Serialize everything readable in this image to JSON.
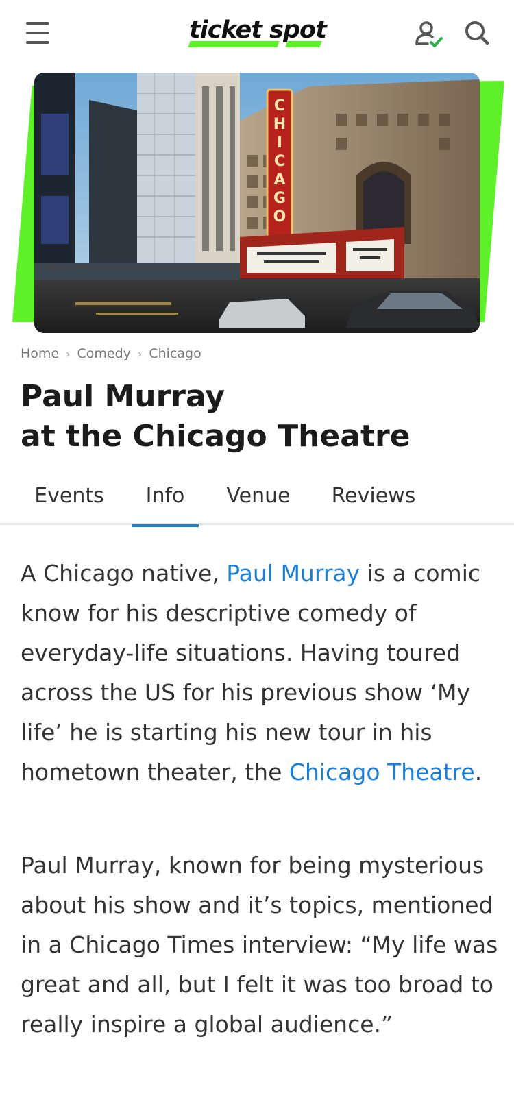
{
  "header": {
    "logo_text": "ticket spot",
    "icons": {
      "menu": "hamburger-menu-icon",
      "user": "user-verified-icon",
      "search": "search-icon"
    },
    "colors": {
      "brand_green": "#5ef12a",
      "verified_green": "#2bb34a"
    }
  },
  "hero": {
    "image": "chicago-theatre-photo",
    "marquee_text": "CHICAGO"
  },
  "breadcrumb": {
    "items": [
      "Home",
      "Comedy",
      "Chicago"
    ],
    "separator": "›"
  },
  "title": {
    "line1": "Paul Murray",
    "line2": "at the Chicago Theatre"
  },
  "tabs": {
    "items": [
      {
        "label": "Events"
      },
      {
        "label": "Info"
      },
      {
        "label": "Venue"
      },
      {
        "label": "Reviews"
      }
    ],
    "active": "Info",
    "accent_color": "#1a7fd8"
  },
  "info": {
    "p1_a": "A Chicago native, ",
    "p1_link1": "Paul Murray",
    "p1_b": " is a comic know for his descriptive comedy of everyday-life situations. Having toured across the US for his previous show ‘My life’ he is starting his new tour in his hometown theater, the ",
    "p1_link2": "Chicago Theatre",
    "p1_c": ".",
    "p2": "Paul Murray, known for being mysterious about his show and it’s topics, mentioned in a Chicago Times interview: “My life was great and all, but I felt it was too broad to really inspire a global audience.”",
    "link_color": "#1a7fd8"
  }
}
